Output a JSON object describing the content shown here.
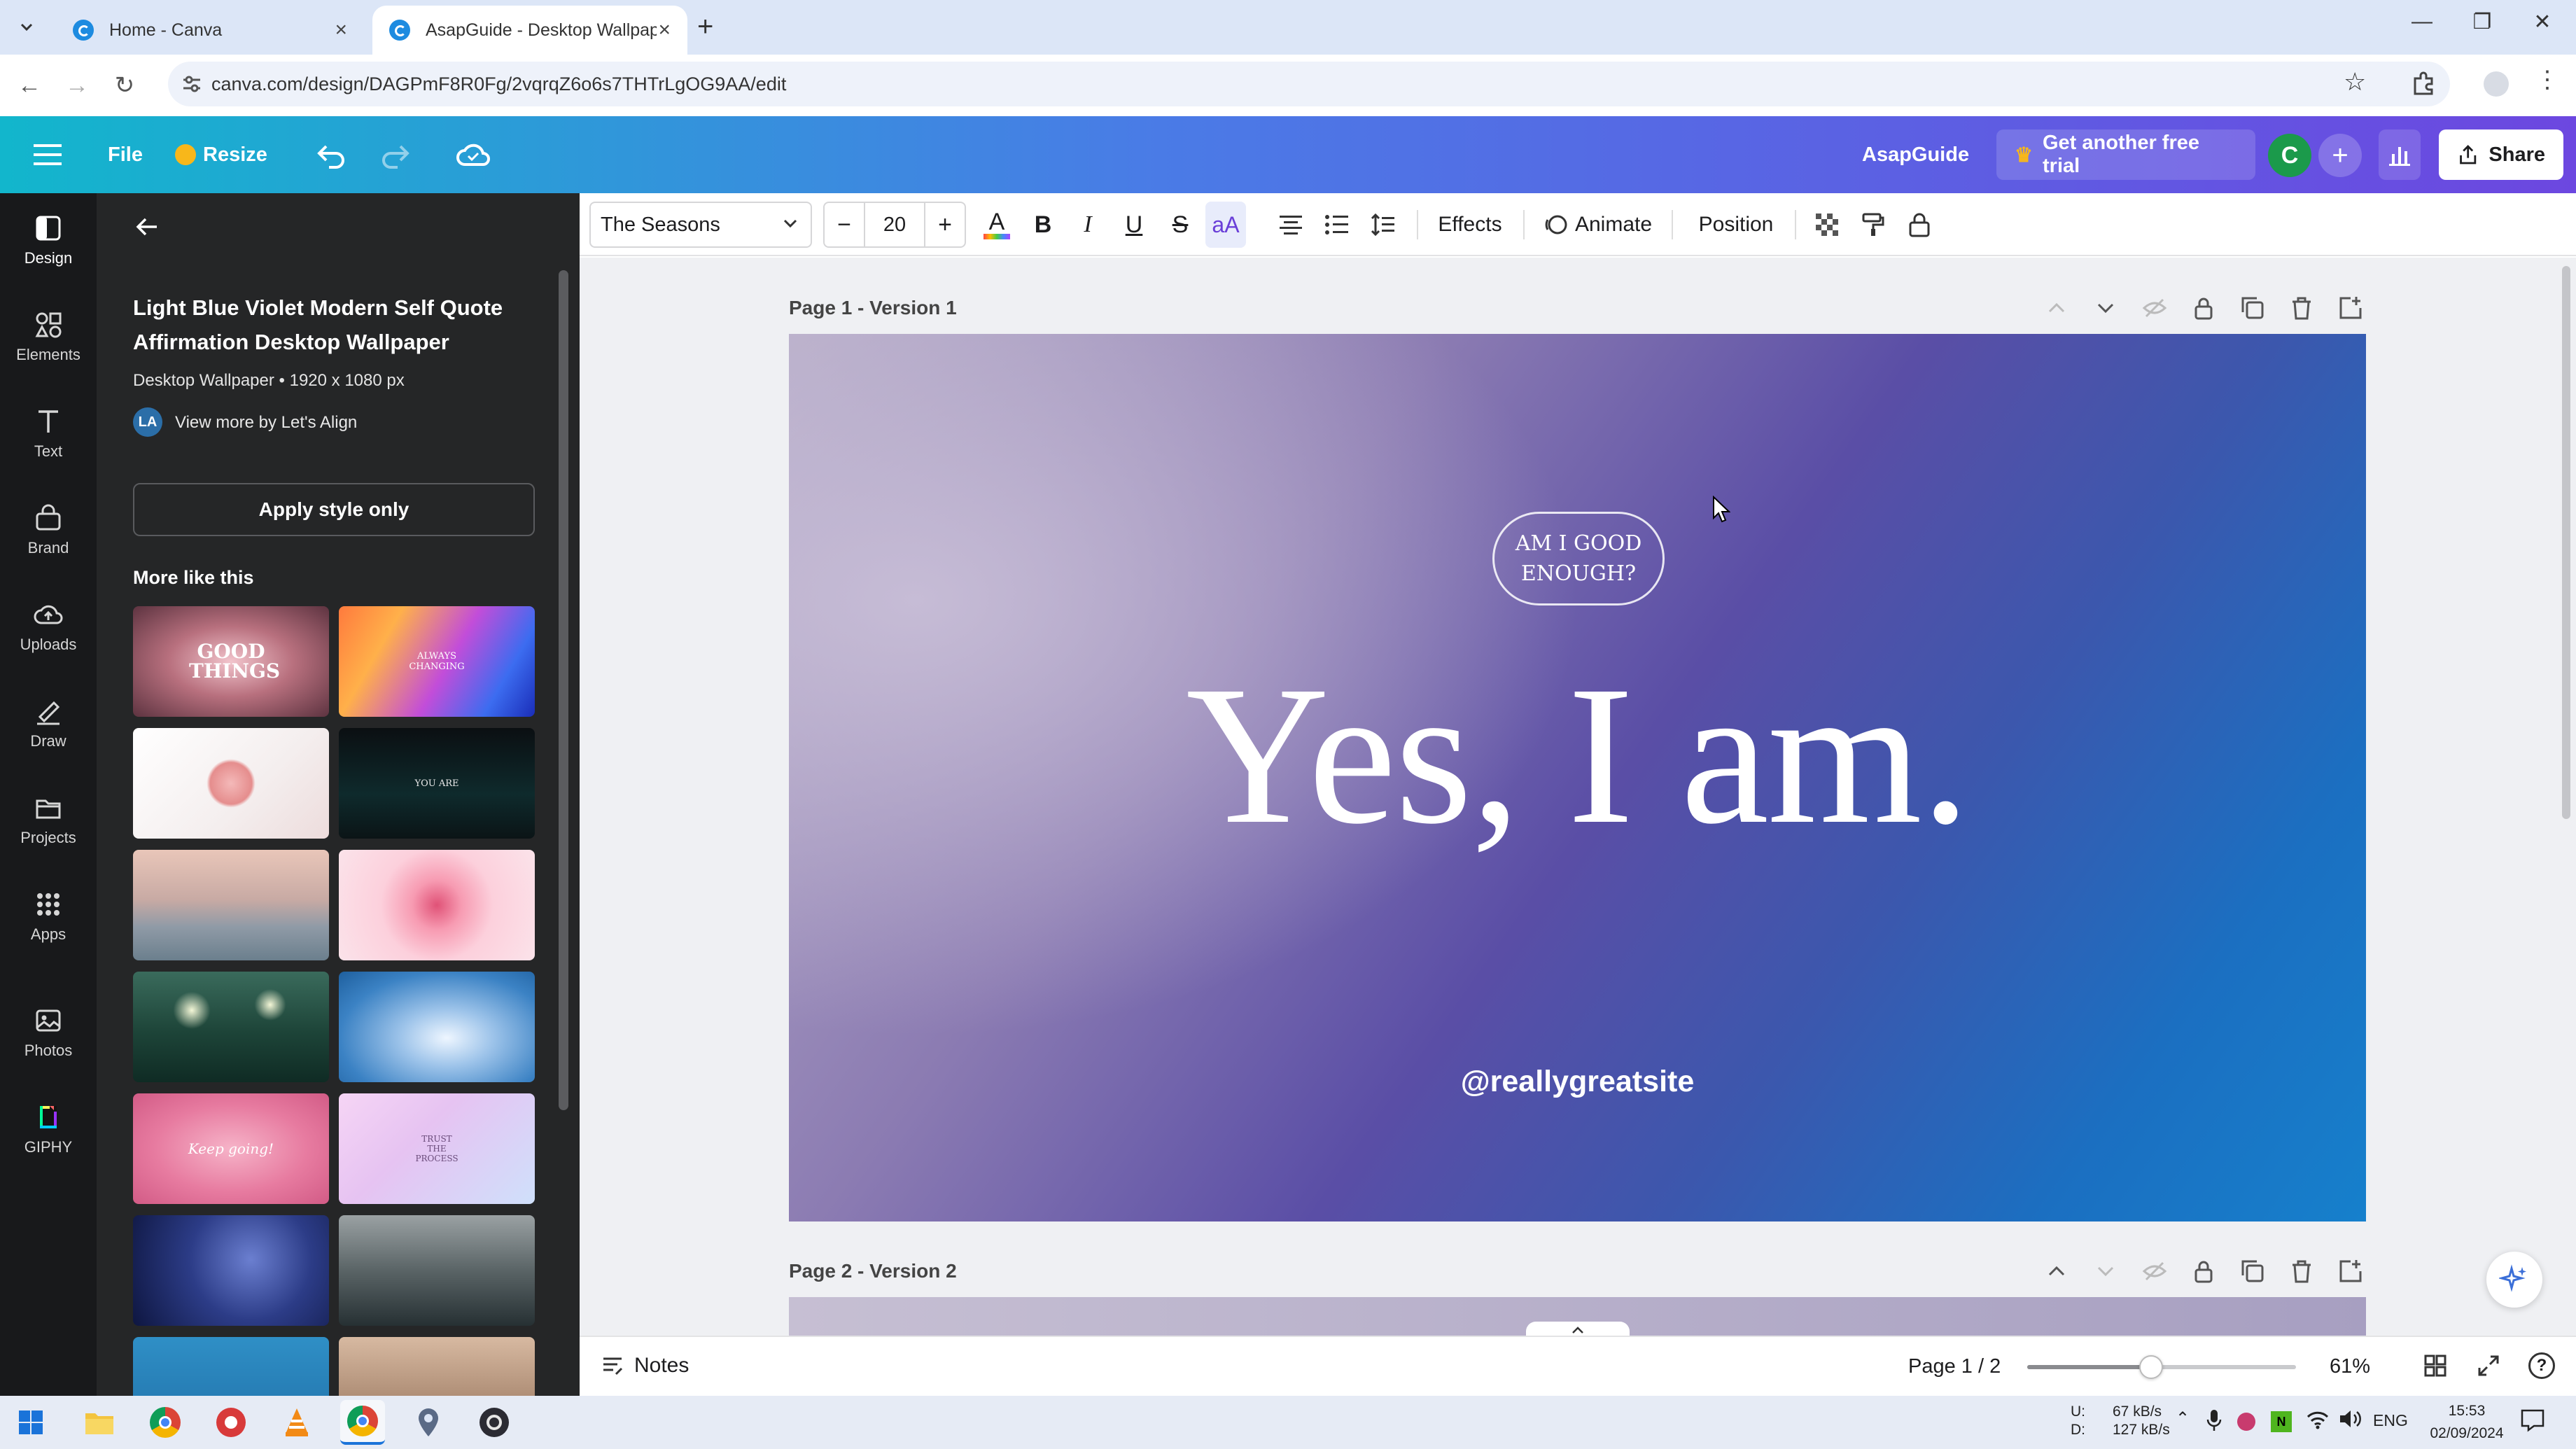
{
  "browser": {
    "tabs": [
      {
        "title": "Home - Canva"
      },
      {
        "title": "AsapGuide - Desktop Wallpape"
      }
    ],
    "url": "canva.com/design/DAGPmF8R0Fg/2vqrqZ6o6s7THTrLgOG9AA/edit"
  },
  "canva_bar": {
    "file_label": "File",
    "resize_label": "Resize",
    "team_name": "AsapGuide",
    "trial_label": "Get another free trial",
    "avatar_letter": "C",
    "share_label": "Share",
    "brand_gradient": [
      "#12b6cc",
      "#4a7be6",
      "#6c47e0"
    ]
  },
  "rail": {
    "items": [
      {
        "label": "Design",
        "icon": "design-icon"
      },
      {
        "label": "Elements",
        "icon": "elements-icon"
      },
      {
        "label": "Text",
        "icon": "text-icon"
      },
      {
        "label": "Brand",
        "icon": "brand-icon"
      },
      {
        "label": "Uploads",
        "icon": "uploads-icon"
      },
      {
        "label": "Draw",
        "icon": "draw-icon"
      },
      {
        "label": "Projects",
        "icon": "projects-icon"
      },
      {
        "label": "Apps",
        "icon": "apps-icon"
      },
      {
        "label": "Photos",
        "icon": "photos-icon"
      },
      {
        "label": "GIPHY",
        "icon": "giphy-icon"
      }
    ]
  },
  "panel": {
    "template_title": "Light Blue Violet Modern Self Quote Affirmation Desktop Wallpaper",
    "template_meta": "Desktop Wallpaper • 1920 x 1080 px",
    "author_initials": "LA",
    "author_link": "View more by Let's Align",
    "apply_style_label": "Apply style only",
    "more_like_this": "More like this",
    "thumbnails": [
      {
        "text": "GOOD THINGS"
      },
      {
        "text": "ALWAYS CHANGING"
      },
      {
        "text": ""
      },
      {
        "text": "YOU ARE"
      },
      {
        "text": ""
      },
      {
        "text": ""
      },
      {
        "text": ""
      },
      {
        "text": ""
      },
      {
        "text": "Keep going!"
      },
      {
        "text": "TRUST THE PROCESS"
      },
      {
        "text": ""
      },
      {
        "text": ""
      },
      {
        "text": ""
      },
      {
        "text": ""
      }
    ]
  },
  "toolbar": {
    "font_name": "The Seasons",
    "font_size": "20",
    "effects_label": "Effects",
    "animate_label": "Animate",
    "position_label": "Position"
  },
  "canvas": {
    "page1_label": "Page 1 - Version 1",
    "page2_label": "Page 2 - Version 2",
    "badge_text": "AM I GOOD ENOUGH?",
    "headline": "Yes, I am.",
    "handle": "@reallygreatsite"
  },
  "bottom": {
    "notes_label": "Notes",
    "page_indicator": "Page 1 / 2",
    "zoom_level": "61%",
    "zoom_fraction": 0.46
  },
  "taskbar": {
    "net_up_label": "U:",
    "net_down_label": "D:",
    "net_up": "67 kB/s",
    "net_down": "127 kB/s",
    "language": "ENG",
    "time": "15:53",
    "date": "02/09/2024"
  }
}
